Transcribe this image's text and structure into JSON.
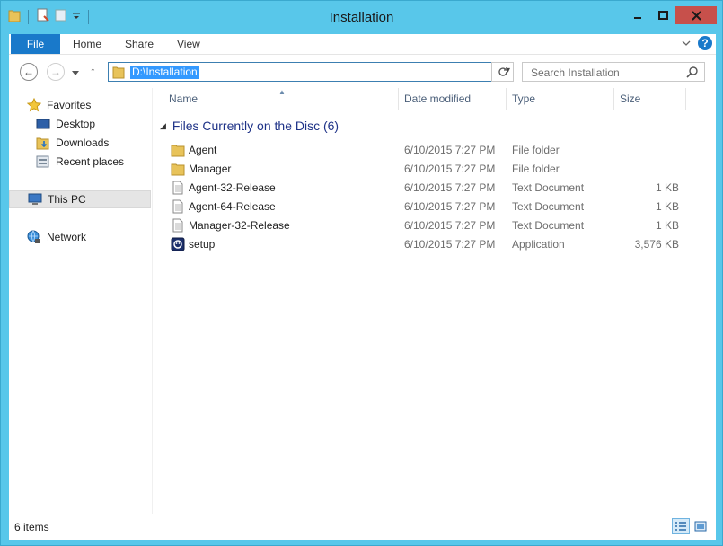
{
  "window": {
    "title": "Installation"
  },
  "ribbon": {
    "tabs": [
      "File",
      "Home",
      "Share",
      "View"
    ],
    "help": "?"
  },
  "navbar": {
    "address": "D:\\Installation",
    "search_placeholder": "Search Installation"
  },
  "navpane": {
    "favorites_label": "Favorites",
    "favorites": [
      "Desktop",
      "Downloads",
      "Recent places"
    ],
    "this_pc": "This PC",
    "network": "Network"
  },
  "columns": {
    "name": "Name",
    "date": "Date modified",
    "type": "Type",
    "size": "Size"
  },
  "group": {
    "label": "Files Currently on the Disc (6)"
  },
  "files": [
    {
      "name": "Agent",
      "date": "6/10/2015 7:27 PM",
      "type": "File folder",
      "size": "",
      "icon": "folder-icon"
    },
    {
      "name": "Manager",
      "date": "6/10/2015 7:27 PM",
      "type": "File folder",
      "size": "",
      "icon": "folder-icon"
    },
    {
      "name": "Agent-32-Release",
      "date": "6/10/2015 7:27 PM",
      "type": "Text Document",
      "size": "1 KB",
      "icon": "text-document-icon"
    },
    {
      "name": "Agent-64-Release",
      "date": "6/10/2015 7:27 PM",
      "type": "Text Document",
      "size": "1 KB",
      "icon": "text-document-icon"
    },
    {
      "name": "Manager-32-Release",
      "date": "6/10/2015 7:27 PM",
      "type": "Text Document",
      "size": "1 KB",
      "icon": "text-document-icon"
    },
    {
      "name": "setup",
      "date": "6/10/2015 7:27 PM",
      "type": "Application",
      "size": "3,576 KB",
      "icon": "setup-app-icon"
    }
  ],
  "status": {
    "items": "6 items"
  },
  "colors": {
    "titlebar": "#58c7ea",
    "accent": "#1979ca",
    "selection": "#3399ff"
  }
}
